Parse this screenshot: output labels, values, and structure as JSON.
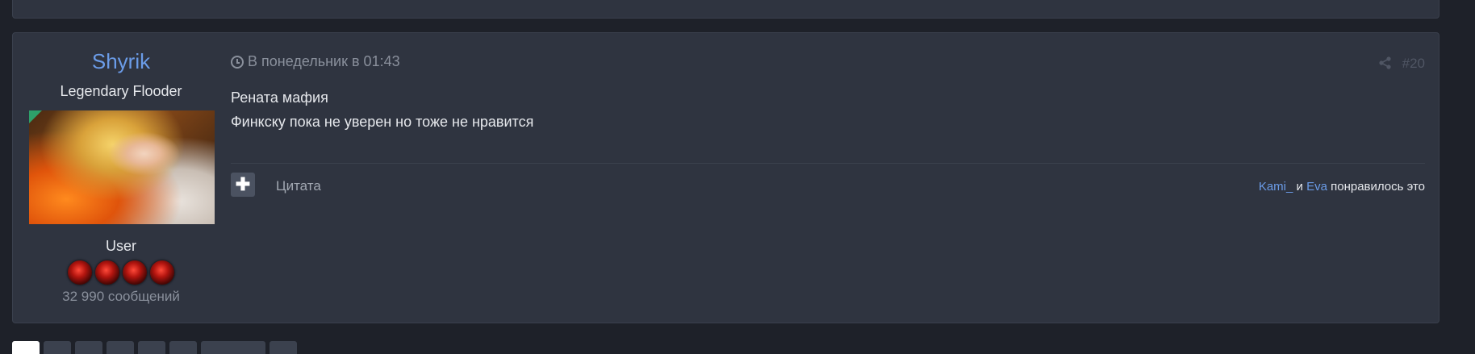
{
  "post": {
    "author": {
      "name": "Shyrik",
      "title": "Legendary Flooder",
      "group": "User",
      "post_count": "32 990 сообщений",
      "rank_icon_count": 4
    },
    "date": "В понедельник в 01:43",
    "number": "#20",
    "content": {
      "line1": "Рената мафия",
      "line2": "Финкску пока не уверен но тоже не нравится"
    },
    "actions": {
      "quote_label": "Цитата",
      "plus_symbol": "✚"
    },
    "likes": {
      "user1": "Kami_",
      "conjunction": " и ",
      "user2": "Eva",
      "suffix": " понравилось это"
    }
  },
  "colors": {
    "accent_link": "#6b9ce8",
    "background": "#1e2129",
    "panel": "#2f3440"
  }
}
